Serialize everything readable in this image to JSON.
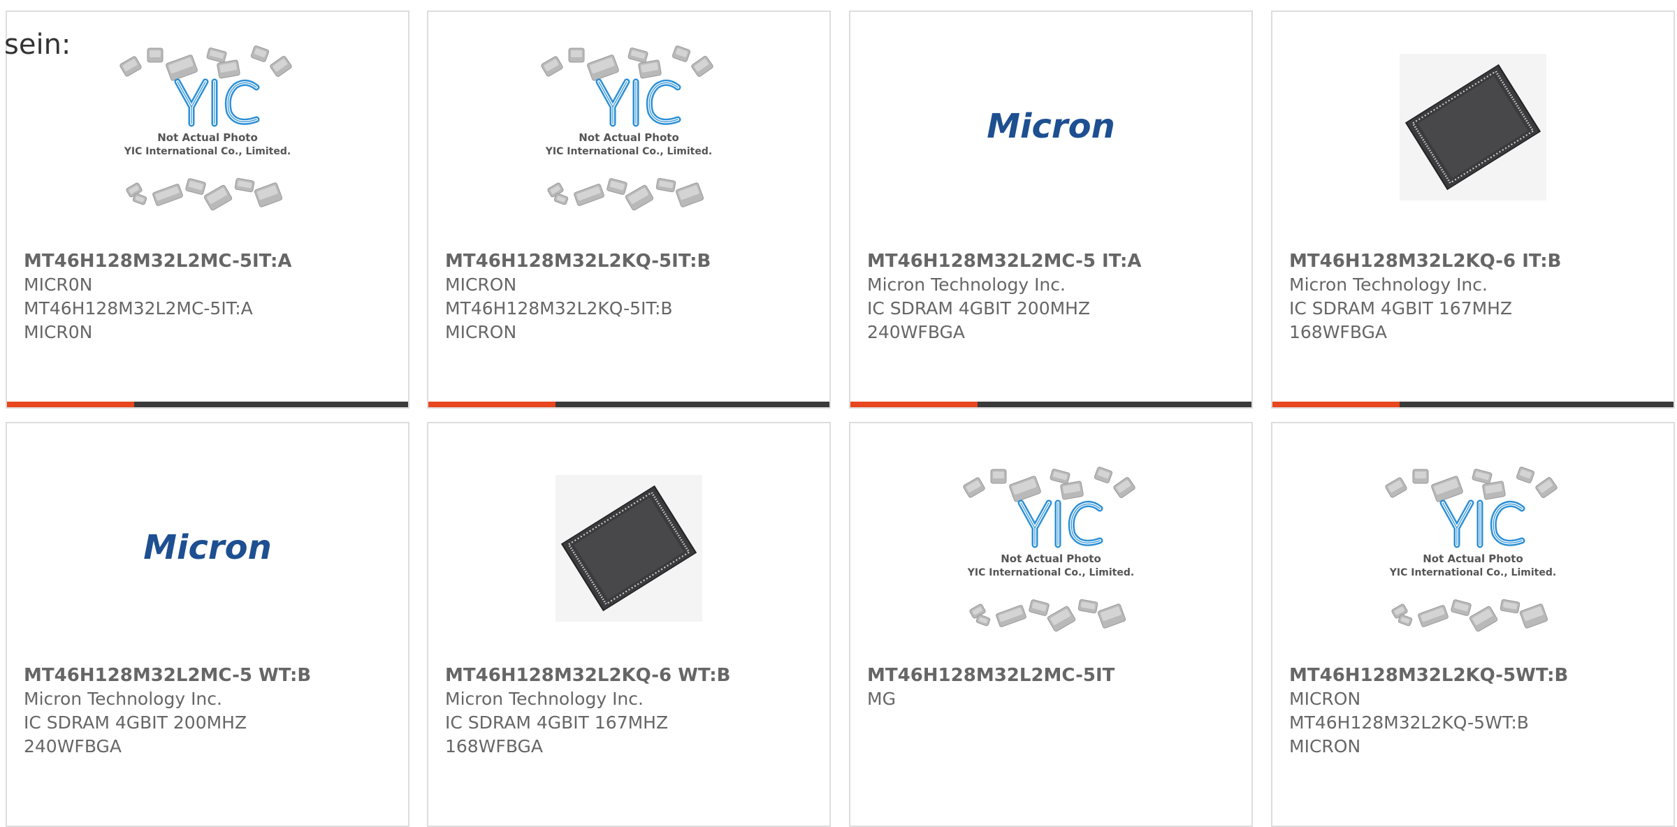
{
  "intro_text": "sein:",
  "colors": {
    "accent": "#e8461e",
    "bar": "#3a3a3a",
    "text": "#666666",
    "micron_blue": "#1d4f91"
  },
  "placeholder": {
    "line1": "Not Actual Photo",
    "line2": "YIC International Co., Limited."
  },
  "logo_text": "Micron",
  "products": [
    {
      "name": "MT46H128M32L2MC-5IT:A",
      "lines": [
        "MICR0N",
        "MT46H128M32L2MC-5IT:A",
        "MICR0N"
      ],
      "image": "yic-placeholder"
    },
    {
      "name": "MT46H128M32L2KQ-5IT:B",
      "lines": [
        "MICRON",
        "MT46H128M32L2KQ-5IT:B",
        "MICRON"
      ],
      "image": "yic-placeholder"
    },
    {
      "name": "MT46H128M32L2MC-5 IT:A",
      "lines": [
        "Micron Technology Inc.",
        "IC SDRAM 4GBIT 200MHZ",
        "240WFBGA"
      ],
      "image": "micron-logo"
    },
    {
      "name": "MT46H128M32L2KQ-6 IT:B",
      "lines": [
        "Micron Technology Inc.",
        "IC SDRAM 4GBIT 167MHZ",
        "168WFBGA"
      ],
      "image": "bga-chip"
    },
    {
      "name": "MT46H128M32L2MC-5 WT:B",
      "lines": [
        "Micron Technology Inc.",
        "IC SDRAM 4GBIT 200MHZ",
        "240WFBGA"
      ],
      "image": "micron-logo"
    },
    {
      "name": "MT46H128M32L2KQ-6 WT:B",
      "lines": [
        "Micron Technology Inc.",
        "IC SDRAM 4GBIT 167MHZ",
        "168WFBGA"
      ],
      "image": "bga-chip"
    },
    {
      "name": "MT46H128M32L2MC-5IT",
      "lines": [
        "MG"
      ],
      "image": "yic-placeholder"
    },
    {
      "name": "MT46H128M32L2KQ-5WT:B",
      "lines": [
        "MICRON",
        "MT46H128M32L2KQ-5WT:B",
        "MICRON"
      ],
      "image": "yic-placeholder"
    }
  ]
}
